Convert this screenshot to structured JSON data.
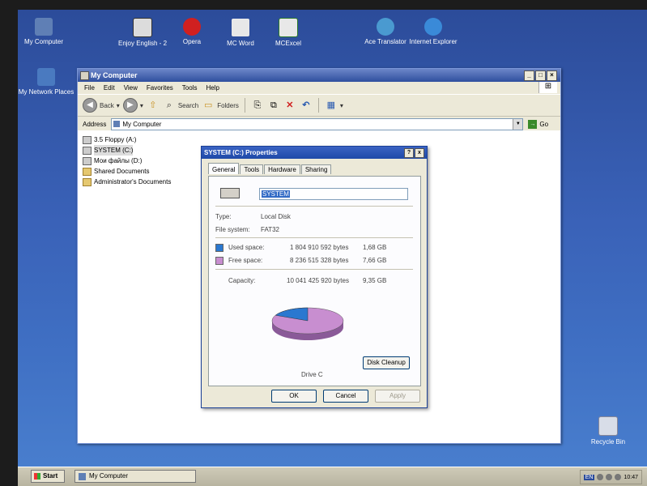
{
  "desktop": {
    "icons": [
      {
        "label": "My Computer",
        "icon": "computer-icon"
      },
      {
        "label": "Enjoy English - 2",
        "icon": "app-icon"
      },
      {
        "label": "Opera",
        "icon": "opera-icon"
      },
      {
        "label": "MC Word",
        "icon": "word-icon"
      },
      {
        "label": "MCExcel",
        "icon": "excel-icon"
      },
      {
        "label": "Ace Translator",
        "icon": "translator-icon"
      },
      {
        "label": "Internet Explorer",
        "icon": "ie-icon"
      },
      {
        "label": "My Network Places",
        "icon": "network-icon"
      },
      {
        "label": "Recycle Bin",
        "icon": "recycle-bin-icon"
      }
    ]
  },
  "explorer": {
    "title": "My Computer",
    "menu": [
      "File",
      "Edit",
      "View",
      "Favorites",
      "Tools",
      "Help"
    ],
    "toolbar": {
      "back": "Back",
      "search": "Search",
      "folders": "Folders"
    },
    "address_label": "Address",
    "address_value": "My Computer",
    "go": "Go",
    "tree": [
      {
        "label": "3.5 Floppy (A:)",
        "icon": "floppy-icon"
      },
      {
        "label": "SYSTEM (C:)",
        "icon": "drive-icon",
        "selected": true
      },
      {
        "label": "Мои файлы (D:)",
        "icon": "drive-icon"
      },
      {
        "label": "Shared Documents",
        "icon": "folder-icon"
      },
      {
        "label": "Administrator's Documents",
        "icon": "folder-icon"
      }
    ]
  },
  "dialog": {
    "title": "SYSTEM (C:) Properties",
    "help_btn": "?",
    "close_btn": "x",
    "tabs": [
      "General",
      "Tools",
      "Hardware",
      "Sharing"
    ],
    "active_tab": "General",
    "name_value": "SYSTEM",
    "type_label": "Type:",
    "type_value": "Local Disk",
    "fs_label": "File system:",
    "fs_value": "FAT32",
    "used_label": "Used space:",
    "used_bytes": "1 804 910 592 bytes",
    "used_gb": "1,68 GB",
    "free_label": "Free space:",
    "free_bytes": "8 236 515 328 bytes",
    "free_gb": "7,66 GB",
    "capacity_label": "Capacity:",
    "capacity_bytes": "10 041 425 920 bytes",
    "capacity_gb": "9,35 GB",
    "drive_label": "Drive C",
    "cleanup_btn": "Disk Cleanup",
    "ok": "OK",
    "cancel": "Cancel",
    "apply": "Apply",
    "used_color": "#2a78d0",
    "free_color": "#c88ed0",
    "used_fraction": 0.18
  },
  "taskbar": {
    "start": "Start",
    "task": "My Computer",
    "lang": "EN",
    "time": "10:47"
  }
}
